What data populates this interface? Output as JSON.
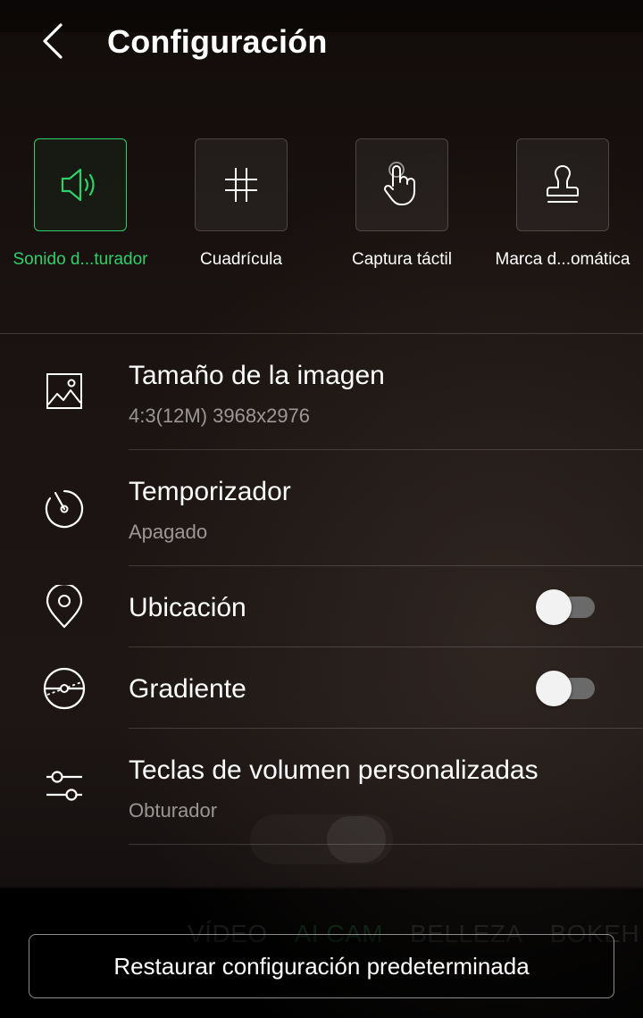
{
  "header": {
    "title": "Configuración"
  },
  "quick_toggles": [
    {
      "label": "Sonido d...turador",
      "icon": "speaker-icon",
      "active": true
    },
    {
      "label": "Cuadrícula",
      "icon": "grid-icon",
      "active": false
    },
    {
      "label": "Captura táctil",
      "icon": "touch-icon",
      "active": false
    },
    {
      "label": "Marca d...omática",
      "icon": "stamp-icon",
      "active": false
    }
  ],
  "settings": {
    "image_size": {
      "title": "Tamaño de la imagen",
      "value": "4:3(12M) 3968x2976",
      "icon": "image-icon"
    },
    "timer": {
      "title": "Temporizador",
      "value": "Apagado",
      "icon": "timer-icon"
    },
    "location": {
      "title": "Ubicación",
      "enabled": false,
      "icon": "location-pin-icon"
    },
    "gradient": {
      "title": "Gradiente",
      "enabled": false,
      "icon": "level-gradient-icon"
    },
    "volume_keys": {
      "title": "Teclas de volumen personalizadas",
      "value": "Obturador",
      "icon": "sliders-icon"
    }
  },
  "background_modes": [
    "VÍDEO",
    "AI CAM",
    "BELLEZA",
    "BOKEH"
  ],
  "restore_button": {
    "label": "Restaurar configuración predeterminada"
  },
  "colors": {
    "accent": "#2fd06a",
    "text_primary": "#ffffff",
    "text_secondary": "#8c8c8c",
    "toggle_track_off": "#6a6a6a"
  }
}
